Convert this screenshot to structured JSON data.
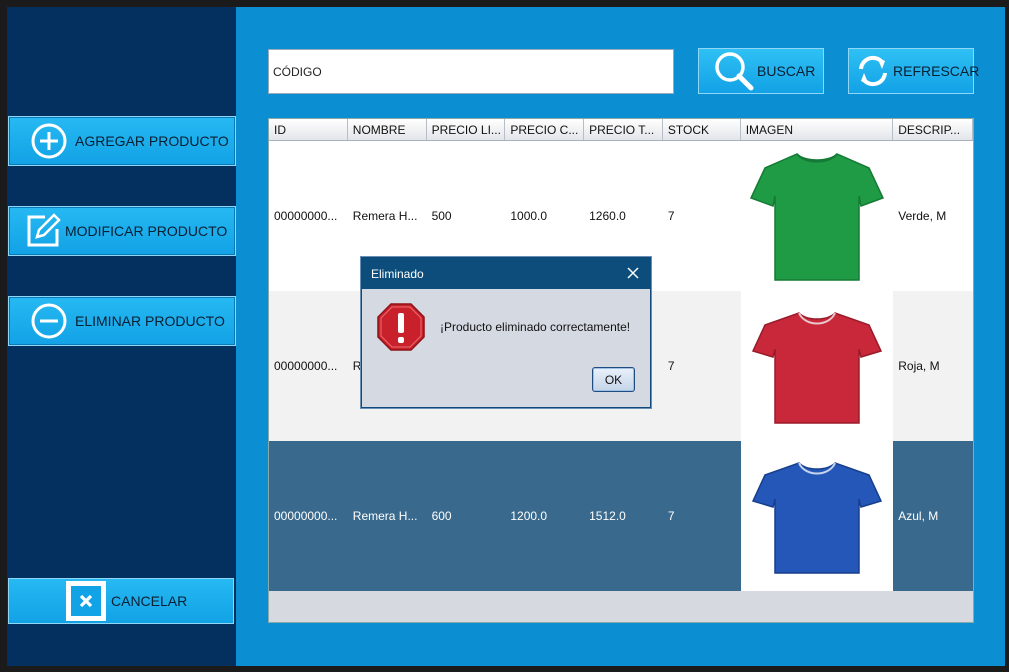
{
  "sidebar": {
    "agregar_label": "AGREGAR PRODUCTO",
    "modificar_label": "MODIFICAR PRODUCTO",
    "eliminar_label": "ELIMINAR PRODUCTO",
    "cancelar_label": "CANCELAR"
  },
  "search": {
    "value": "CÓDIGO",
    "buscar_label": "BUSCAR",
    "refrescar_label": "REFRESCAR"
  },
  "table": {
    "columns": [
      "ID",
      "NOMBRE",
      "PRECIO LI...",
      "PRECIO C...",
      "PRECIO T...",
      "STOCK",
      "IMAGEN",
      "DESCRIP..."
    ],
    "rows": [
      {
        "id": "00000000...",
        "nombre": "Remera H...",
        "precio_li": "500",
        "precio_c": "1000.0",
        "precio_t": "1260.0",
        "stock": "7",
        "imagen": "green-tshirt",
        "descripcion": "Verde, M"
      },
      {
        "id": "00000000...",
        "nombre": "R",
        "precio_li": "",
        "precio_c": "",
        "precio_t": "",
        "stock": "7",
        "imagen": "red-tshirt",
        "descripcion": "Roja, M"
      },
      {
        "id": "00000000...",
        "nombre": "Remera H...",
        "precio_li": "600",
        "precio_c": "1200.0",
        "precio_t": "1512.0",
        "stock": "7",
        "imagen": "blue-tshirt",
        "descripcion": "Azul, M"
      }
    ]
  },
  "dialog": {
    "title": "Eliminado",
    "message": "¡Producto eliminado correctamente!",
    "ok_label": "OK"
  },
  "colors": {
    "sidebar_bg": "#03305e",
    "main_bg": "#0b8fd2",
    "button": "#12a2e6",
    "selected_row": "#39698c",
    "dialog_titlebar": "#0d4d7c",
    "shirt_green": "#1f9a45",
    "shirt_red": "#c8283a",
    "shirt_blue": "#2457b8"
  }
}
